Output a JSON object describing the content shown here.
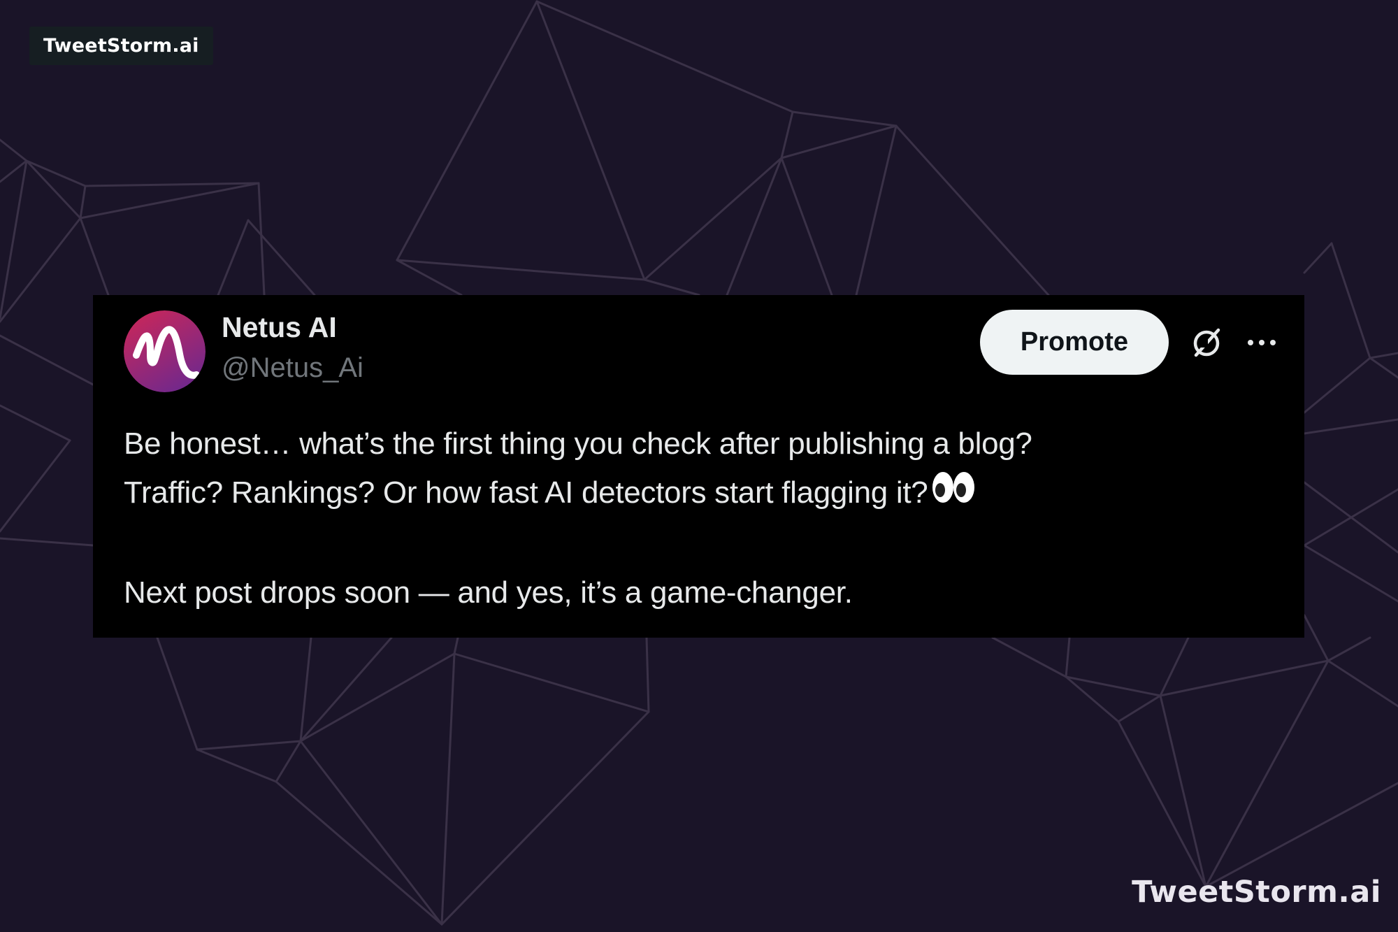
{
  "brand_tag": "TweetStorm.ai",
  "watermark": "TweetStorm.ai",
  "colors": {
    "background": "#1a1428",
    "mesh_lines": "#3a3147",
    "card": "#000000",
    "text_primary": "#e7e9ea",
    "text_secondary": "#71767b",
    "avatar_gradient_top": "#c8245a",
    "avatar_gradient_bottom": "#7a2a8a"
  },
  "tweet": {
    "author_name": "Netus AI",
    "author_handle": "@Netus_Ai",
    "promote_label": "Promote",
    "icons": {
      "avatar": "netus-logo-icon",
      "grok": "grok-icon",
      "more": "more-options-icon",
      "emoji": "eyes-emoji-icon"
    },
    "line1": "Be honest… what’s the first thing you check after publishing a blog?",
    "line2": "Traffic? Rankings? Or how fast AI detectors start flagging it?",
    "line3": "Next post drops soon — and yes, it’s a game-changer."
  }
}
